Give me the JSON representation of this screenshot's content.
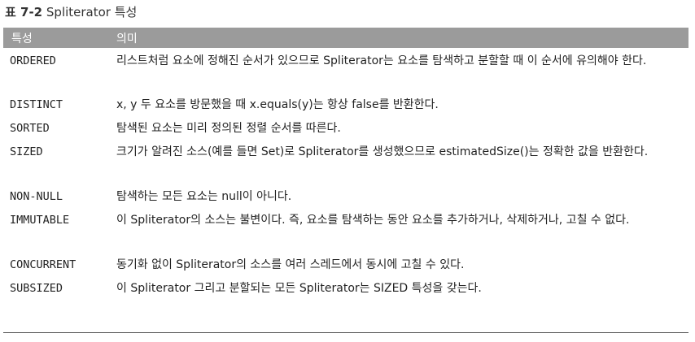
{
  "caption": {
    "label": "표 7-2",
    "title": "Spliterator 특성"
  },
  "table": {
    "headers": [
      "특성",
      "의미"
    ],
    "rows": [
      {
        "key": "ORDERED",
        "value": "리스트처럼 요소에 정해진 순서가 있으므로 Spliterator는 요소를 탐색하고 분할할 때 이 순서에 유의해야 한다."
      },
      {
        "key": "DISTINCT",
        "value": "x, y 두 요소를 방문했을 때 x.equals(y)는 항상 false를 반환한다."
      },
      {
        "key": "SORTED",
        "value": "탐색된 요소는 미리 정의된 정렬 순서를 따른다."
      },
      {
        "key": "SIZED",
        "value": "크기가 알려진 소스(예를 들면 Set)로 Spliterator를 생성했으므로 estimatedSize()는 정확한 값을 반환한다."
      },
      {
        "key": "NON-NULL",
        "value": "탐색하는 모든 요소는 null이 아니다."
      },
      {
        "key": "IMMUTABLE",
        "value": "이 Spliterator의 소스는 불변이다. 즉, 요소를 탐색하는 동안 요소를 추가하거나, 삭제하거나, 고칠 수 없다."
      },
      {
        "key": "CONCURRENT",
        "value": "동기화 없이 Spliterator의 소스를 여러 스레드에서 동시에 고칠 수 있다."
      },
      {
        "key": "SUBSIZED",
        "value": "이 Spliterator 그리고 분할되는 모든 Spliterator는 SIZED 특성을 갖는다."
      }
    ]
  }
}
